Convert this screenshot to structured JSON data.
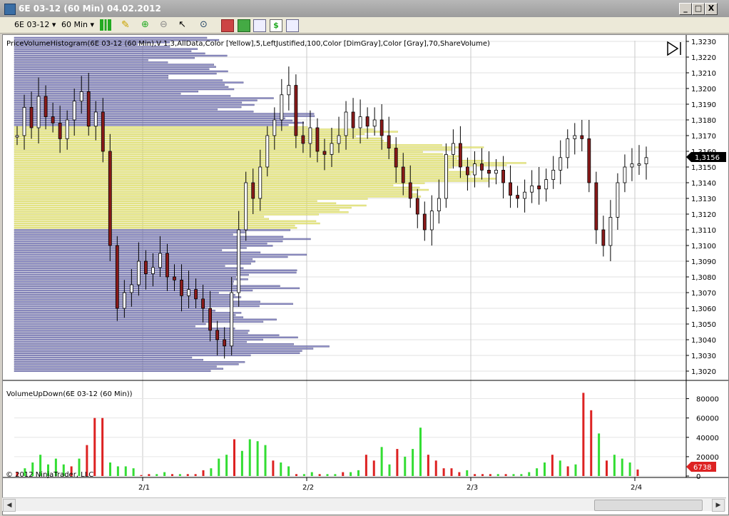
{
  "window": {
    "title": "6E 03-12 (60 Min)  04.02.2012",
    "minimize": "_",
    "maximize": "□",
    "close": "X"
  },
  "toolbar": {
    "instrument": "6E 03-12",
    "interval": "60 Min"
  },
  "price_panel": {
    "indicator_label": "PriceVolumeHistogram(6E 03-12 (60 Min),V 1.3,AllData,Color [Yellow],5,LeftJustified,100,Color [DimGray],Color [Gray],70,ShareVolume)",
    "y_ticks": [
      "1,3230",
      "1,3220",
      "1,3210",
      "1,3200",
      "1,3190",
      "1,3180",
      "1,3170",
      "1,3160",
      "1,3150",
      "1,3140",
      "1,3130",
      "1,3120",
      "1,3110",
      "1,3100",
      "1,3090",
      "1,3080",
      "1,3070",
      "1,3060",
      "1,3050",
      "1,3040",
      "1,3030",
      "1,3020"
    ],
    "last_price": "1,3156",
    "colors": {
      "histogram": "#8080c0",
      "value_area": "#e8e87a",
      "up_candle": "#ffffff",
      "down_candle": "#8b1a1a"
    }
  },
  "volume_panel": {
    "indicator_label": "VolumeUpDown(6E 03-12 (60 Min))",
    "y_ticks": [
      "80000",
      "60000",
      "40000",
      "20000",
      "0"
    ],
    "last_volume": "6738",
    "colors": {
      "up": "#33dd33",
      "down": "#dd2222"
    }
  },
  "x_axis": {
    "labels": [
      "2/1",
      "2/2",
      "2/3",
      "2/4"
    ]
  },
  "copyright": "© 2012 NinjaTrader, LLC",
  "chart_data": {
    "type": "bar",
    "title": "",
    "price_levels": [
      1.323,
      1.322,
      1.321,
      1.32,
      1.319,
      1.318,
      1.317,
      1.316,
      1.315,
      1.314,
      1.313,
      1.312,
      1.311,
      1.31,
      1.309,
      1.308,
      1.307,
      1.306,
      1.305,
      1.304,
      1.303,
      1.302
    ],
    "volume_ylim": [
      0,
      90000
    ],
    "volume_series": [
      {
        "v": 4000,
        "c": "down"
      },
      {
        "v": 8000,
        "c": "up"
      },
      {
        "v": 14000,
        "c": "up"
      },
      {
        "v": 22000,
        "c": "up"
      },
      {
        "v": 12000,
        "c": "up"
      },
      {
        "v": 18000,
        "c": "up"
      },
      {
        "v": 12000,
        "c": "up"
      },
      {
        "v": 10000,
        "c": "down"
      },
      {
        "v": 18000,
        "c": "up"
      },
      {
        "v": 32000,
        "c": "down"
      },
      {
        "v": 60000,
        "c": "down"
      },
      {
        "v": 60000,
        "c": "down"
      },
      {
        "v": 14000,
        "c": "up"
      },
      {
        "v": 10000,
        "c": "up"
      },
      {
        "v": 10000,
        "c": "up"
      },
      {
        "v": 8000,
        "c": "up"
      },
      {
        "v": 1000,
        "c": "down"
      },
      {
        "v": 2000,
        "c": "down"
      },
      {
        "v": 2000,
        "c": "up"
      },
      {
        "v": 4000,
        "c": "up"
      },
      {
        "v": 2000,
        "c": "down"
      },
      {
        "v": 2000,
        "c": "up"
      },
      {
        "v": 2000,
        "c": "down"
      },
      {
        "v": 2000,
        "c": "down"
      },
      {
        "v": 6000,
        "c": "down"
      },
      {
        "v": 8000,
        "c": "up"
      },
      {
        "v": 18000,
        "c": "up"
      },
      {
        "v": 22000,
        "c": "up"
      },
      {
        "v": 38000,
        "c": "down"
      },
      {
        "v": 26000,
        "c": "up"
      },
      {
        "v": 38000,
        "c": "green"
      },
      {
        "v": 36000,
        "c": "up"
      },
      {
        "v": 32000,
        "c": "up"
      },
      {
        "v": 16000,
        "c": "down"
      },
      {
        "v": 14000,
        "c": "up"
      },
      {
        "v": 10000,
        "c": "up"
      },
      {
        "v": 2000,
        "c": "down"
      },
      {
        "v": 2000,
        "c": "up"
      },
      {
        "v": 4000,
        "c": "up"
      },
      {
        "v": 2000,
        "c": "down"
      },
      {
        "v": 2000,
        "c": "up"
      },
      {
        "v": 2000,
        "c": "up"
      },
      {
        "v": 4000,
        "c": "down"
      },
      {
        "v": 4000,
        "c": "up"
      },
      {
        "v": 6000,
        "c": "up"
      },
      {
        "v": 22000,
        "c": "down"
      },
      {
        "v": 16000,
        "c": "down"
      },
      {
        "v": 30000,
        "c": "up"
      },
      {
        "v": 12000,
        "c": "up"
      },
      {
        "v": 28000,
        "c": "down"
      },
      {
        "v": 20000,
        "c": "up"
      },
      {
        "v": 28000,
        "c": "up"
      },
      {
        "v": 50000,
        "c": "up"
      },
      {
        "v": 22000,
        "c": "down"
      },
      {
        "v": 16000,
        "c": "down"
      },
      {
        "v": 8000,
        "c": "down"
      },
      {
        "v": 8000,
        "c": "down"
      },
      {
        "v": 4000,
        "c": "down"
      },
      {
        "v": 6000,
        "c": "up"
      },
      {
        "v": 2000,
        "c": "down"
      },
      {
        "v": 2000,
        "c": "down"
      },
      {
        "v": 2000,
        "c": "down"
      },
      {
        "v": 2000,
        "c": "up"
      },
      {
        "v": 2000,
        "c": "down"
      },
      {
        "v": 2000,
        "c": "up"
      },
      {
        "v": 2000,
        "c": "up"
      },
      {
        "v": 4000,
        "c": "up"
      },
      {
        "v": 8000,
        "c": "up"
      },
      {
        "v": 14000,
        "c": "up"
      },
      {
        "v": 22000,
        "c": "down"
      },
      {
        "v": 16000,
        "c": "up"
      },
      {
        "v": 10000,
        "c": "down"
      },
      {
        "v": 12000,
        "c": "up"
      },
      {
        "v": 86000,
        "c": "down"
      },
      {
        "v": 68000,
        "c": "down"
      },
      {
        "v": 44000,
        "c": "up"
      },
      {
        "v": 16000,
        "c": "down"
      },
      {
        "v": 22000,
        "c": "up"
      },
      {
        "v": 18000,
        "c": "up"
      },
      {
        "v": 14000,
        "c": "up"
      },
      {
        "v": 6738,
        "c": "down"
      }
    ]
  }
}
